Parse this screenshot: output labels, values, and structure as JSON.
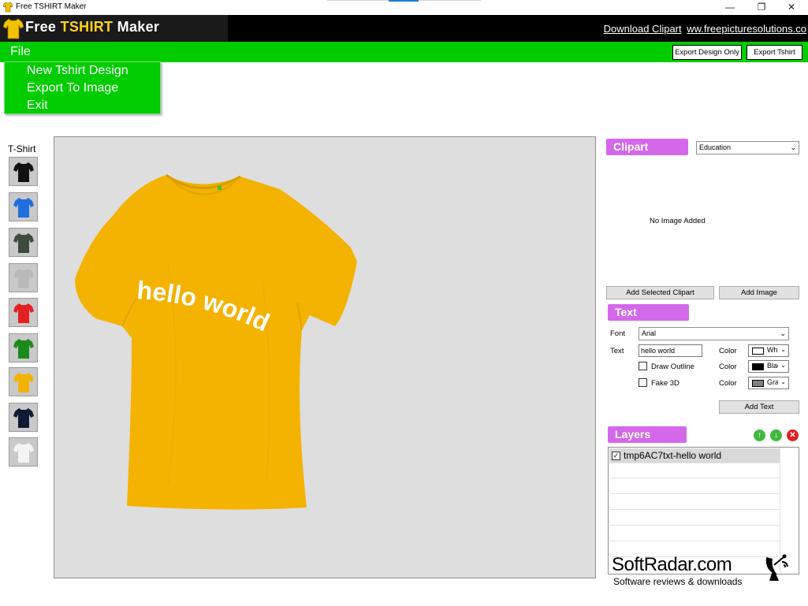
{
  "window": {
    "title": "Free TSHIRT Maker",
    "controls": {
      "minimize": "—",
      "maximize": "❐",
      "close": "✕"
    }
  },
  "header": {
    "logo_prefix": "Free",
    "logo_accent": "TSHIRT",
    "logo_suffix": "Maker",
    "link_clipart": "Download Clipart",
    "link_site": "ww.freepicturesolutions.co"
  },
  "menubar": {
    "file_label": "File",
    "export_design_label": "Export Design Only",
    "export_tshirt_label": "Export Tshirt"
  },
  "file_menu": {
    "items": [
      "New Tshirt Design",
      "Export To Image",
      "Exit"
    ]
  },
  "tshirt_panel": {
    "label": "T-Shirt",
    "colors": [
      "#111111",
      "#1f6fe0",
      "#3d4a3d",
      "#b9b9b9",
      "#e52020",
      "#1b8a1b",
      "#f2b300",
      "#0e1b33",
      "#f4f4f4"
    ]
  },
  "canvas": {
    "shirt_color": "#f3b300",
    "text": "hello world",
    "text_color": "#ffffff"
  },
  "clipart": {
    "title": "Clipart",
    "category": "Education",
    "empty_text": "No Image Added",
    "add_selected_label": "Add Selected Clipart",
    "add_image_label": "Add Image"
  },
  "text_panel": {
    "title": "Text",
    "font_label": "Font",
    "font_value": "Arial",
    "text_label": "Text",
    "text_value": "hello world",
    "color_label": "Color",
    "draw_outline_label": "Draw Outline",
    "fake3d_label": "Fake 3D",
    "text_color_name": "White",
    "outline_color_name": "Black",
    "fake3d_color_name": "Gray",
    "text_color_hex": "#ffffff",
    "outline_color_hex": "#000000",
    "fake3d_color_hex": "#808080",
    "add_text_label": "Add Text"
  },
  "layers": {
    "title": "Layers",
    "items": [
      "tmp6AC7txt-hello world"
    ],
    "up_icon": "↑",
    "down_icon": "↓",
    "delete_icon": "✕"
  },
  "watermark": {
    "brand": "SoftRadar.com",
    "tagline": "Software reviews & downloads"
  },
  "colors": {
    "menu_green": "#00cc00",
    "section_purple": "#d468ea",
    "header_black": "#000000"
  }
}
